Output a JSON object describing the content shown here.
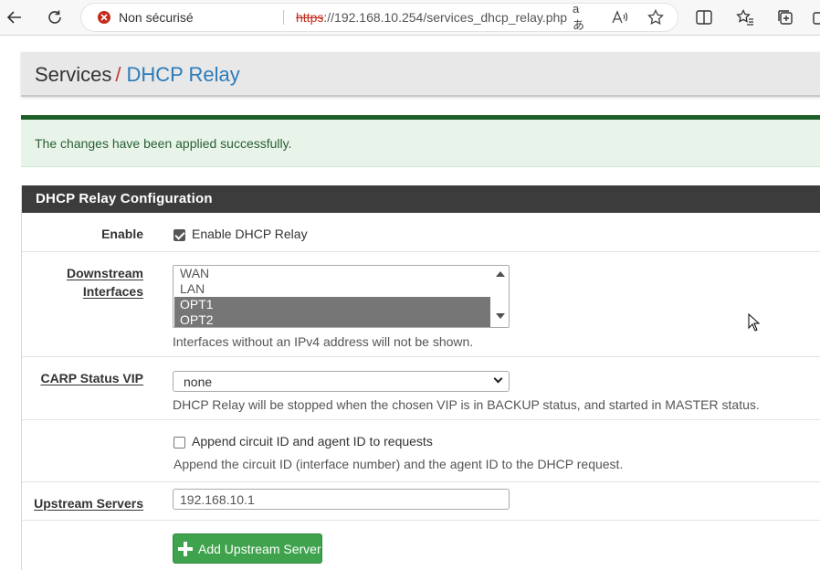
{
  "browser": {
    "security_text": "Non sécurisé",
    "url_protocol": "https",
    "url_rest": "://192.168.10.254/services_dhcp_relay.php",
    "read_aloud_glyph": "aあ"
  },
  "breadcrumb": {
    "section": "Services",
    "separator": "/",
    "page": "DHCP Relay"
  },
  "alert": {
    "message": "The changes have been applied successfully."
  },
  "panel": {
    "title": "DHCP Relay Configuration",
    "enable": {
      "label": "Enable",
      "checkbox_label": "Enable DHCP Relay",
      "checked": true
    },
    "downstream": {
      "label_line1": "Downstream",
      "label_line2": "Interfaces",
      "options": [
        {
          "label": "WAN",
          "selected": false
        },
        {
          "label": "LAN",
          "selected": false
        },
        {
          "label": "OPT1",
          "selected": true
        },
        {
          "label": "OPT2",
          "selected": true
        }
      ],
      "help": "Interfaces without an IPv4 address will not be shown."
    },
    "carp": {
      "label": "CARP Status VIP",
      "selected": "none",
      "help": "DHCP Relay will be stopped when the chosen VIP is in BACKUP status, and started in MASTER status."
    },
    "circuit": {
      "checkbox_label": "Append circuit ID and agent ID to requests",
      "checked": false,
      "help": "Append the circuit ID (interface number) and the agent ID to the DHCP request."
    },
    "upstream": {
      "label": "Upstream Servers",
      "value": "192.168.10.1"
    },
    "add_button_label": "Add Upstream Server"
  },
  "colors": {
    "success_bar": "#1e5e28",
    "panel_header": "#3c3c3c",
    "add_button": "#3fa34d",
    "breadcrumb_page": "#2b7bb9",
    "insecure_red": "#c42b1c"
  }
}
